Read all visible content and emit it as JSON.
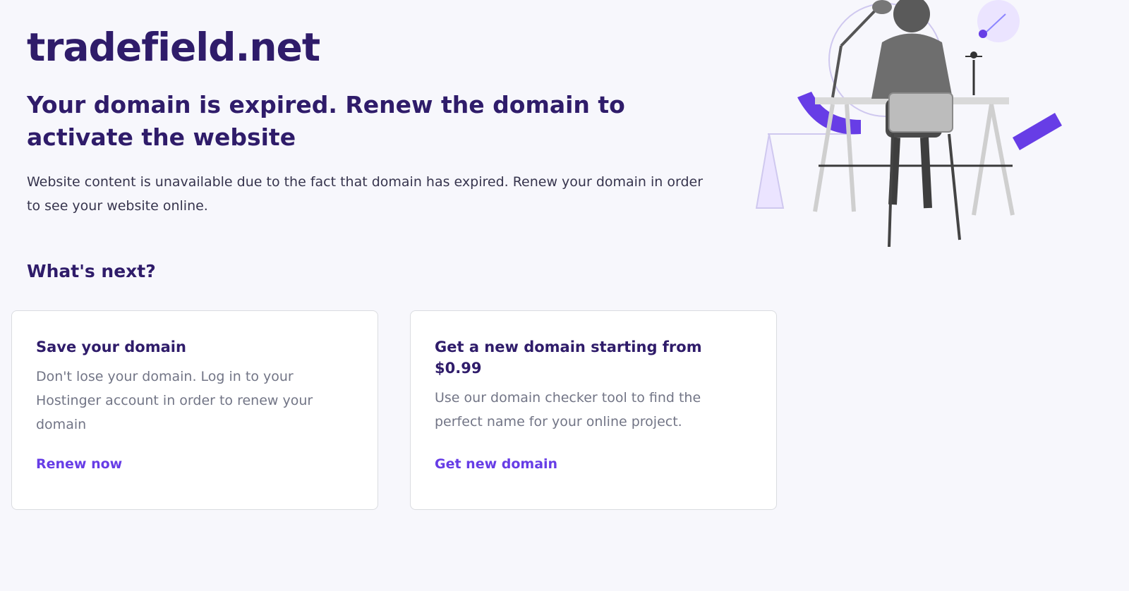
{
  "domain_name": "tradefield.net",
  "headline": "Your domain is expired. Renew the domain to activate the website",
  "lead": "Website content is unavailable due to the fact that domain has expired. Renew your domain in order to see your website online.",
  "whats_next": "What's next?",
  "cards": [
    {
      "title": "Save your domain",
      "text": "Don't lose your domain. Log in to your Hostinger account in order to renew your domain",
      "link": "Renew now"
    },
    {
      "title": "Get a new domain starting from $0.99",
      "text": "Use our domain checker tool to find the perfect name for your online project.",
      "link": "Get new domain"
    }
  ],
  "colors": {
    "primary_text": "#2f1c6a",
    "accent": "#673de6",
    "muted": "#727586",
    "background": "#f7f7fc"
  },
  "illustration": "person-at-desk-illustration"
}
